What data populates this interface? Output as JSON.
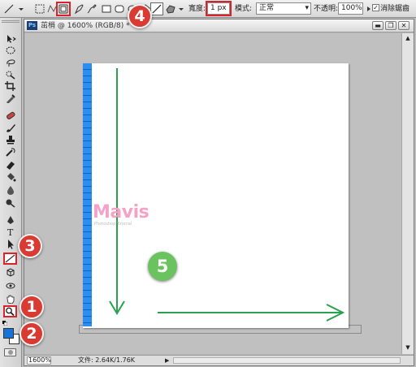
{
  "options_bar": {
    "width_label": "寬度:",
    "width_value": "1 px",
    "mode_label": "模式:",
    "mode_value": "正常",
    "opacity_label": "不透明:",
    "opacity_value": "100%",
    "antialias_label": "消除鋸齒",
    "antialias_checked": true
  },
  "document": {
    "tab_icon": "Ps",
    "title": "茁梢 @ 1600% (RGB/8) *",
    "zoom": "1600%",
    "file_info": "文件: 2.64K/1.76K"
  },
  "watermark": {
    "title": "Mavis",
    "subtitle": "Photoshop Tutorial"
  },
  "callouts": [
    {
      "number": "1",
      "color": "#d93a32"
    },
    {
      "number": "2",
      "color": "#d93a32"
    },
    {
      "number": "3",
      "color": "#d93a32"
    },
    {
      "number": "4",
      "color": "#d93a32"
    },
    {
      "number": "5",
      "color": "#6ac35f"
    }
  ],
  "colors": {
    "highlight": "#d8232a",
    "arrow": "#29a14f",
    "strip": "#1873d9"
  },
  "tools": [
    "move-tool",
    "marquee-tool",
    "lasso-tool",
    "quick-select-tool",
    "crop-tool",
    "eyedropper-tool",
    "healing-brush-tool",
    "brush-tool",
    "clone-stamp-tool",
    "history-brush-tool",
    "eraser-tool",
    "paint-bucket-tool",
    "blur-tool",
    "dodge-tool",
    "pen-tool",
    "type-tool",
    "path-select-tool",
    "line-tool",
    "3d-rotate-tool",
    "3d-orbit-tool",
    "hand-tool",
    "zoom-tool"
  ]
}
